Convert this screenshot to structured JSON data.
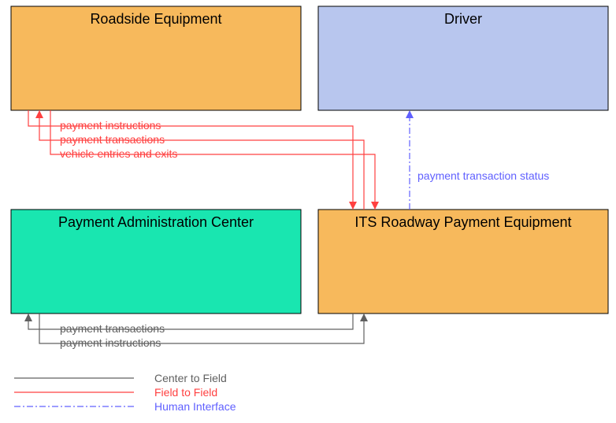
{
  "chart_data": {
    "type": "diagram",
    "nodes": [
      {
        "id": "roadside",
        "label": "Roadside Equipment",
        "color": "#f7b95c"
      },
      {
        "id": "driver",
        "label": "Driver",
        "color": "#b8c6ee"
      },
      {
        "id": "payAdmin",
        "label": "Payment Administration Center",
        "color": "#19e6b0"
      },
      {
        "id": "itsPay",
        "label": "ITS Roadway Payment Equipment",
        "color": "#f7b95c"
      }
    ],
    "flows": [
      {
        "from": "roadside",
        "to": "itsPay",
        "label": "payment instructions",
        "type": "field_to_field"
      },
      {
        "from": "itsPay",
        "to": "roadside",
        "label": "payment transactions",
        "type": "field_to_field"
      },
      {
        "from": "roadside",
        "to": "itsPay",
        "label": "vehicle entries and exits",
        "type": "field_to_field"
      },
      {
        "from": "itsPay",
        "to": "driver",
        "label": "payment transaction status",
        "type": "human_interface"
      },
      {
        "from": "itsPay",
        "to": "payAdmin",
        "label": "payment transactions",
        "type": "center_to_field"
      },
      {
        "from": "payAdmin",
        "to": "itsPay",
        "label": "payment instructions",
        "type": "center_to_field"
      }
    ],
    "legend": [
      {
        "key": "center_to_field",
        "label": "Center to Field"
      },
      {
        "key": "field_to_field",
        "label": "Field to Field"
      },
      {
        "key": "human_interface",
        "label": "Human Interface"
      }
    ]
  },
  "boxes": {
    "roadside": "Roadside Equipment",
    "driver": "Driver",
    "payAdmin": "Payment Administration Center",
    "itsPay": "ITS Roadway Payment Equipment"
  },
  "flowLabels": {
    "f1": "payment instructions",
    "f2": "payment transactions",
    "f3": "vehicle entries and exits",
    "f4": "payment transaction status",
    "f5": "payment transactions",
    "f6": "payment instructions"
  },
  "legend": {
    "l1": "Center to Field",
    "l2": "Field to Field",
    "l3": "Human Interface"
  }
}
